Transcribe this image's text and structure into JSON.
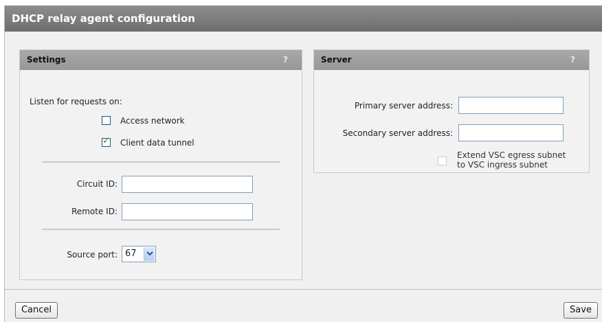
{
  "window": {
    "title": "DHCP relay agent configuration"
  },
  "settings": {
    "header": "Settings",
    "help": "?",
    "listen_label": "Listen for requests on:",
    "access_network": {
      "label": "Access network",
      "checked": false
    },
    "client_data_tunnel": {
      "label": "Client data tunnel",
      "checked": true
    },
    "circuit_id": {
      "label": "Circuit ID:",
      "value": ""
    },
    "remote_id": {
      "label": "Remote ID:",
      "value": ""
    },
    "source_port": {
      "label": "Source port:",
      "value": "67"
    }
  },
  "server": {
    "header": "Server",
    "help": "?",
    "primary": {
      "label": "Primary server address:",
      "value": ""
    },
    "secondary": {
      "label": "Secondary server address:",
      "value": ""
    },
    "extend_vsc": {
      "label_line1": "Extend VSC egress subnet",
      "label_line2": "to VSC ingress subnet",
      "checked": false,
      "enabled": false
    }
  },
  "buttons": {
    "cancel": "Cancel",
    "save": "Save"
  }
}
